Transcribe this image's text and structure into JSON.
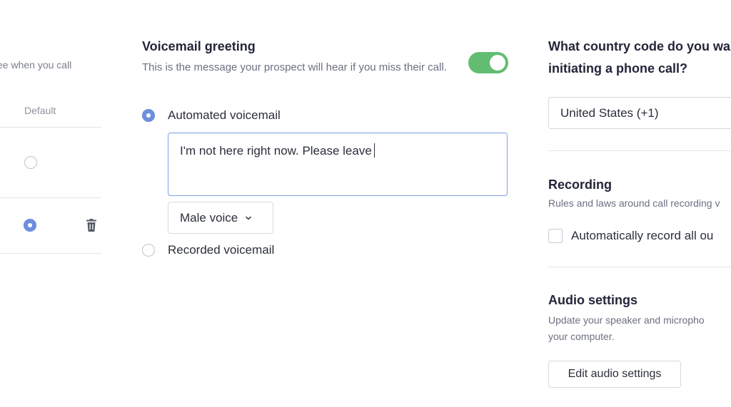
{
  "left": {
    "subtitle": "ee when you call",
    "column_header": "Default",
    "rows": [
      {
        "default": false
      },
      {
        "default": true
      }
    ]
  },
  "voicemail": {
    "title": "Voicemail greeting",
    "description": "This is the message your prospect will hear if you miss their call.",
    "enabled": true,
    "options": [
      {
        "label": "Automated voicemail",
        "selected": true
      },
      {
        "label": "Recorded voicemail",
        "selected": false
      }
    ],
    "message_value": "I'm not here right now. Please leave",
    "voice_select": "Male voice"
  },
  "country": {
    "title_line1": "What country code do you wa",
    "title_line2": "initiating a phone call?",
    "selected": "United States (+1)"
  },
  "recording": {
    "title": "Recording",
    "description": "Rules and laws around call recording v",
    "checkbox_label": "Automatically record all ou",
    "checked": false
  },
  "audio": {
    "title": "Audio settings",
    "description_line1": "Update your speaker and micropho",
    "description_line2": "your computer.",
    "button_label": "Edit audio settings"
  },
  "colors": {
    "accent": "#6f8fdc",
    "toggle_on": "#62bd73",
    "focus_border": "#7ea1e6"
  },
  "icons": [
    "trash-icon",
    "chevron-down-icon"
  ]
}
